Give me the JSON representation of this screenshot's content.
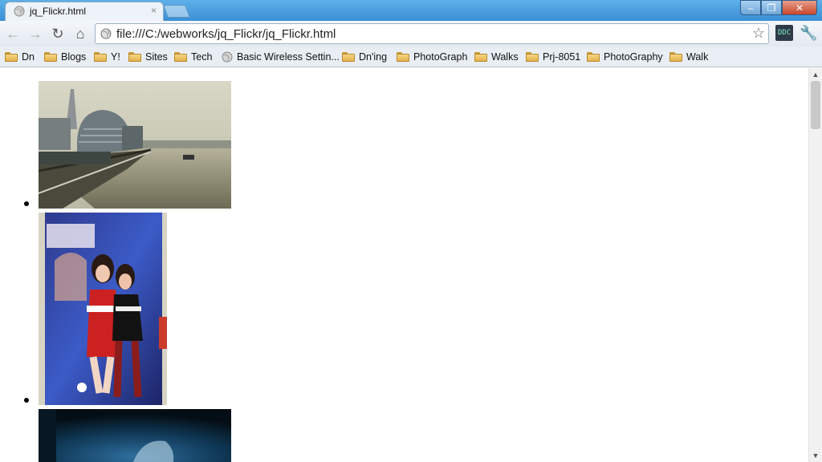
{
  "window": {
    "tab_title": "jq_Flickr.html",
    "tab_close": "×",
    "controls": {
      "minimize": "‒",
      "restore": "❐",
      "close": "✕"
    }
  },
  "toolbar": {
    "back": "←",
    "forward": "→",
    "reload": "↻",
    "home": "⌂",
    "url": "file:///C:/webworks/jq_Flickr/jq_Flickr.html",
    "star": "☆",
    "extension_label": "DDC",
    "wrench": "🔧"
  },
  "bookmarks": [
    {
      "label": "Dn",
      "icon": "folder-icon"
    },
    {
      "label": "Blogs",
      "icon": "folder-icon"
    },
    {
      "label": "Y!",
      "icon": "folder-icon"
    },
    {
      "label": "Sites",
      "icon": "folder-icon"
    },
    {
      "label": "Tech",
      "icon": "folder-icon"
    },
    {
      "label": "Basic Wireless Settin...",
      "icon": "globe-icon"
    },
    {
      "label": "Dn'ing",
      "icon": "folder-icon"
    },
    {
      "label": "PhotoGraph",
      "icon": "folder-icon"
    },
    {
      "label": "Walks",
      "icon": "folder-icon"
    },
    {
      "label": "Prj-8051",
      "icon": "folder-icon"
    },
    {
      "label": "PhotoGraphy",
      "icon": "folder-icon"
    },
    {
      "label": "Walk",
      "icon": "folder-icon"
    }
  ],
  "photos": [
    {
      "subject": "city-hall-riverside-photo"
    },
    {
      "subject": "game-event-cosplay-photo"
    },
    {
      "subject": "dark-blue-stage-photo"
    }
  ],
  "colors": {
    "titlebar": "#3a8fd6",
    "bookmark_bar": "#e9eef4",
    "page_bg": "#ffffff"
  }
}
